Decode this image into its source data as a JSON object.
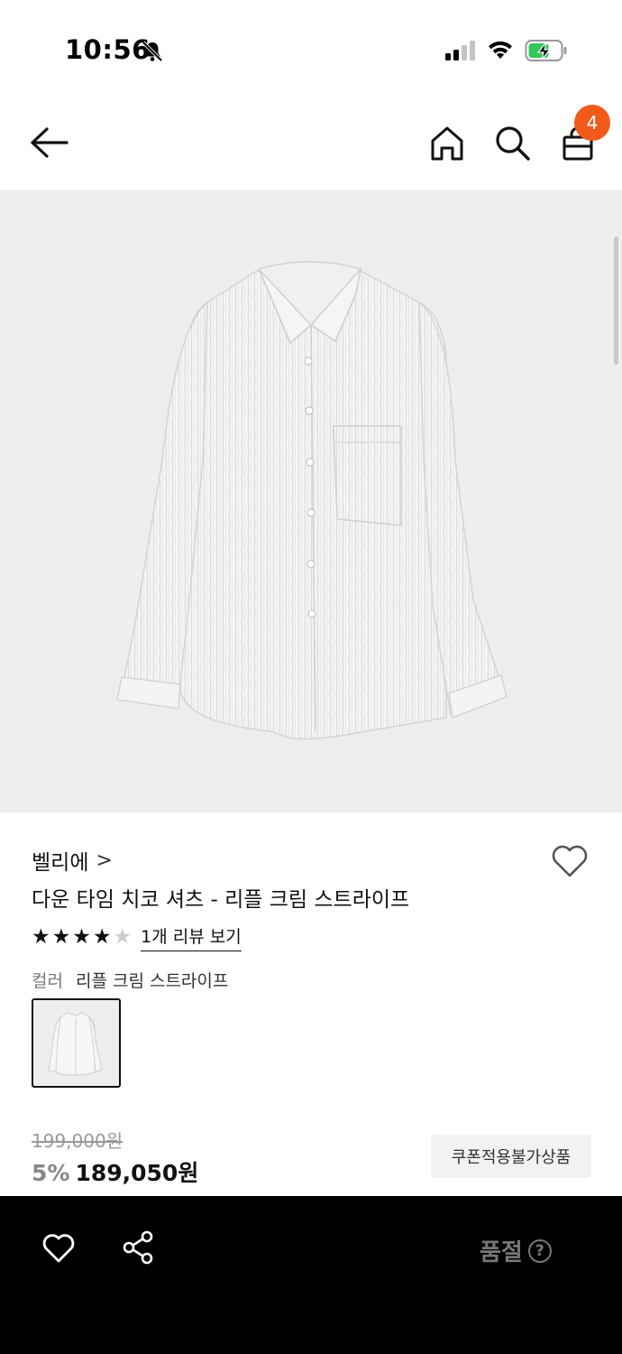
{
  "status_bar": {
    "time": "10:56"
  },
  "nav": {
    "cart_count": "4"
  },
  "product": {
    "brand": "벨리에",
    "brand_chevron": ">",
    "name": "다운 타임 치코 셔츠 - 리플 크림 스트라이프",
    "rating": 4,
    "rating_max": 5,
    "review_link": "1개 리뷰 보기",
    "color_label": "컬러",
    "color_value": "리플 크림 스트라이프",
    "original_price": "199,000원",
    "discount": "5%",
    "sale_price": "189,050원",
    "coupon_badge": "쿠폰적용불가상품"
  },
  "bottom_bar": {
    "soldout_label": "품절",
    "help_glyph": "?"
  },
  "icons": {
    "back": "arrow-left-icon",
    "home": "home-icon",
    "search": "search-icon",
    "cart": "shopping-bag-icon",
    "wishlist": "heart-icon",
    "share": "share-icon"
  },
  "colors": {
    "badge": "#f25a1a",
    "bottom_bar": "#000000",
    "image_bg": "#eeeeee"
  }
}
